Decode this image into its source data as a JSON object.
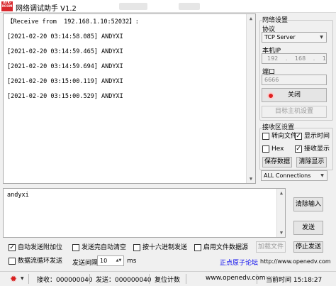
{
  "window": {
    "logo_text": "ATK-XCOM",
    "title": "网络调试助手 V1.2"
  },
  "receive": {
    "header": "【Receive from  192.168.1.10:52032】:",
    "lines": [
      "[2021-02-20 03:14:58.085] ANDYXI",
      "[2021-02-20 03:14:59.465] ANDYXI",
      "[2021-02-20 03:14:59.694] ANDYXI",
      "[2021-02-20 03:15:00.119] ANDYXI",
      "[2021-02-20 03:15:00.529] ANDYXI"
    ]
  },
  "send": {
    "text": "andyxi"
  },
  "network": {
    "group_title": "网络设置",
    "protocol_label": "协议",
    "protocol_value": "TCP Server",
    "local_ip_label": "本机IP",
    "ip_parts": [
      "192",
      "168",
      "1",
      "20"
    ],
    "port_label": "端口",
    "port_value": "6666",
    "close_button": "关闭",
    "target_button": "目标主机设置"
  },
  "recv_settings": {
    "group_title": "接收区设置",
    "to_file": "转向文件",
    "show_time": "显示时间",
    "hex": "Hex",
    "show_recv": "接收显示",
    "save_button": "保存数据",
    "clear_button": "清除显示",
    "connections_value": "ALL Connections"
  },
  "send_buttons": {
    "clear_input": "清除输入",
    "send": "发送"
  },
  "options": {
    "auto_append": "自动发送附加位",
    "clear_after_send": "发送完自动清空",
    "hex_send": "按十六进制发送",
    "file_source": "启用文件数据源",
    "load_file": "加载文件",
    "stop_send": "停止发送",
    "loop_send": "数据流循环发送",
    "interval_label": "发送间隔",
    "interval_value": "10",
    "interval_unit": "ms",
    "forum_link": "正点原子论坛",
    "url": "http://www.openedv.com"
  },
  "status": {
    "recv": "接收：000000040",
    "send": "发送：000000040",
    "reset": "复位计数",
    "site": "www.openedv.com",
    "time": "当前时间 15:18:27"
  }
}
